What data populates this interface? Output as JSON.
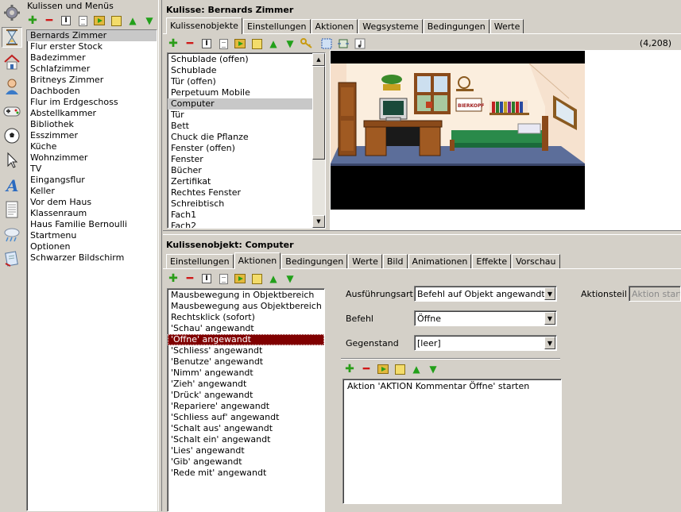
{
  "left_panel": {
    "header": "Kulissen und Menüs",
    "items": [
      "Bernards Zimmer",
      "Flur erster Stock",
      "Badezimmer",
      "Schlafzimmer",
      "Britneys Zimmer",
      "Dachboden",
      "Flur im Erdgeschoss",
      "Abstellkammer",
      "Bibliothek",
      "Esszimmer",
      "Küche",
      "Wohnzimmer",
      "TV",
      "Eingangsflur",
      "Keller",
      "Vor dem Haus",
      "Klassenraum",
      "Haus Familie Bernoulli",
      "Startmenu",
      "Optionen",
      "Schwarzer Bildschirm"
    ],
    "selected_index": 0
  },
  "iconbar": [
    "gear-icon",
    "hourglass-icon",
    "house-icon",
    "person-icon",
    "gamepad-icon",
    "ball-icon",
    "cursor-icon",
    "font-icon",
    "document-icon",
    "weather-icon",
    "script-icon"
  ],
  "scene": {
    "title": "Kulisse: Bernards Zimmer",
    "tabs": [
      "Kulissenobjekte",
      "Einstellungen",
      "Aktionen",
      "Wegsysteme",
      "Bedingungen",
      "Werte"
    ],
    "active_tab": 0,
    "coords": "(4,208)",
    "objects": [
      "Schublade (offen)",
      "Schublade",
      "Tür (offen)",
      "Perpetuum Mobile",
      "Computer",
      "Tür",
      "Bett",
      "Chuck die Pflanze",
      "Fenster (offen)",
      "Fenster",
      "Bücher",
      "Zertifikat",
      "Rechtes Fenster",
      "Schreibtisch",
      "Fach1",
      "Fach2"
    ],
    "selected_object": 4,
    "poster_text": "BIERKOPF"
  },
  "object": {
    "title": "Kulissenobjekt: Computer",
    "tabs": [
      "Einstellungen",
      "Aktionen",
      "Bedingungen",
      "Werte",
      "Bild",
      "Animationen",
      "Effekte",
      "Vorschau"
    ],
    "active_tab": 1,
    "events": [
      "Mausbewegung in Objektbereich",
      "Mausbewegung aus Objektbereich",
      "Rechtsklick (sofort)",
      "'Schau' angewandt",
      "'Öffne' angewandt",
      "'Schliess' angewandt",
      "'Benutze' angewandt",
      "'Nimm' angewandt",
      "'Zieh' angewandt",
      "'Drück' angewandt",
      "'Repariere' angewandt",
      "'Schliess auf' angewandt",
      "'Schalt aus' angewandt",
      "'Schalt ein' angewandt",
      "'Lies' angewandt",
      "'Gib' angewandt",
      "'Rede mit' angewandt"
    ],
    "selected_event": 4,
    "form": {
      "ausfuehrungsart_label": "Ausführungsart",
      "ausfuehrungsart_value": "Befehl auf Objekt angewandt",
      "befehl_label": "Befehl",
      "befehl_value": "Öffne",
      "gegenstand_label": "Gegenstand",
      "gegenstand_value": "[leer]",
      "aktionsteil_label": "Aktionsteil",
      "aktionsteil_value": "Aktion starten"
    },
    "action_text": "Aktion 'AKTION Kommentar Öffne' starten"
  },
  "colors": {
    "selection_red": "#800000",
    "selection_gray": "#c8c8c8",
    "accent_green": "#2a9d18",
    "accent_red": "#d01818"
  }
}
